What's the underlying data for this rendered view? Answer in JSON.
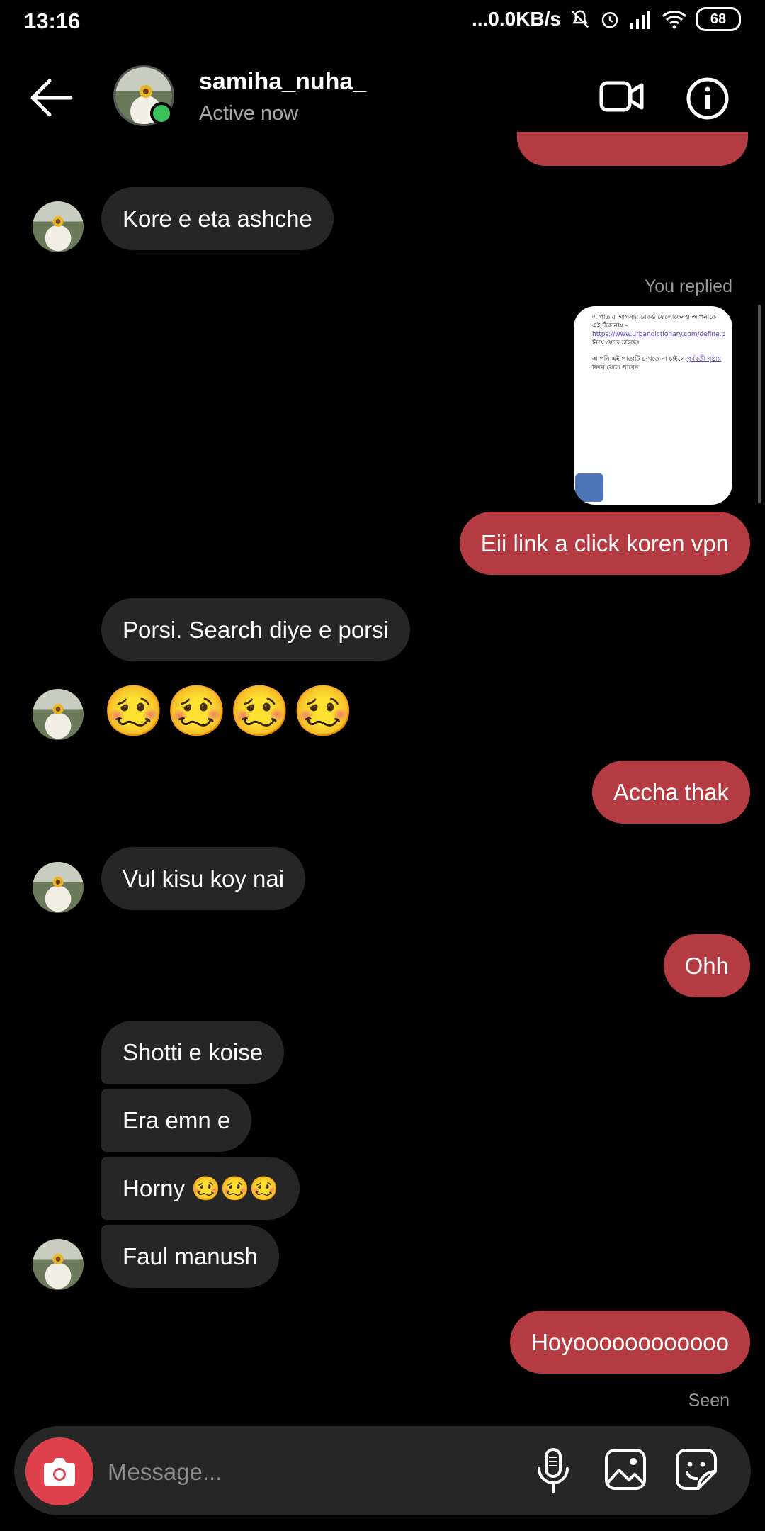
{
  "status_bar": {
    "time": "13:16",
    "network_speed": "...0.0KB/s",
    "battery": "68",
    "icons": [
      "mute-icon",
      "alarm-icon",
      "signal-icon",
      "wifi-icon",
      "battery-icon"
    ]
  },
  "header": {
    "username": "samiha_nuha_",
    "activity": "Active now",
    "icons": [
      "back-arrow-icon",
      "video-call-icon",
      "info-icon"
    ],
    "online_color": "#3ac15a"
  },
  "messages": {
    "m1": "Kore e eta ashche",
    "you_replied": "You replied",
    "m2": "Eii link a click koren vpn",
    "m3": "Porsi. Search diye e porsi",
    "m4": "🥴🥴🥴🥴",
    "m5": "Accha thak",
    "m6": "Vul kisu koy nai",
    "m7": "Ohh",
    "m8": "Shotti e koise",
    "m9": "Era emn e",
    "m10": "Horny 🥴🥴🥴",
    "m11": "Faul manush",
    "m12": "Hoyoooooooooooo",
    "seen": "Seen"
  },
  "reply_preview": {
    "line1": "এ পাতার আপনার রেকর্ড ফেলোফেনও আপনাকে এই ঠিকানায় -",
    "link": "https://www.urbandictionary.com/define.php",
    "line2": "নিয়ে যেতে চাইছে।",
    "line3": "আপনি এই পাতাটি দেখতে না চাইলে",
    "link2": "পূর্ববর্তী পৃষ্ঠায়",
    "line4": "ফিরে যেতে পারেন।"
  },
  "composer": {
    "placeholder": "Message...",
    "icons": [
      "camera-icon",
      "microphone-icon",
      "gallery-icon",
      "sticker-icon"
    ]
  },
  "colors": {
    "outgoing_bubble": "#b33b41",
    "incoming_bubble": "#262626",
    "camera_button": "#e0424d"
  }
}
